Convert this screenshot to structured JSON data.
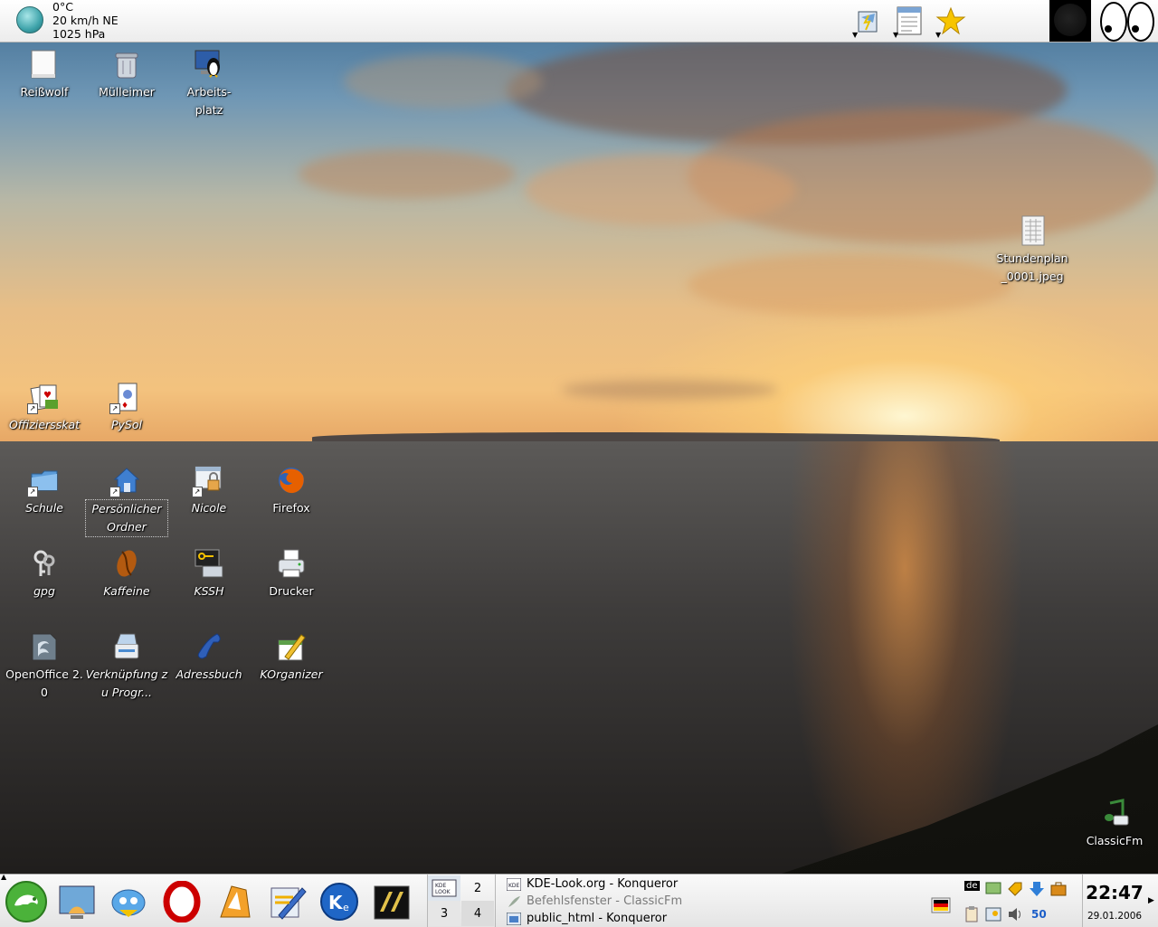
{
  "weather": {
    "temperature": "0°C",
    "wind": "20 km/h NE",
    "pressure": "1025 hPa",
    "icon": "weather-globe-icon"
  },
  "top_panel": {
    "buttons": [
      "klipper-icon",
      "notes-icon",
      "bookmark-star-icon"
    ],
    "applets": [
      "moon-phase",
      "eyes"
    ]
  },
  "desktop": {
    "icons": [
      {
        "name": "shredder",
        "label": "Reißwolf",
        "italic": false
      },
      {
        "name": "trash",
        "label": "Mülleimer",
        "italic": false
      },
      {
        "name": "my-computer",
        "label": "Arbeits-\nplatz",
        "italic": false
      },
      {
        "name": "timetable-file",
        "label": "Stundenplan\n_0001.jpeg",
        "italic": false
      },
      {
        "name": "offiziersskat",
        "label": "Offiziersskat",
        "italic": true
      },
      {
        "name": "pysol",
        "label": "PySol",
        "italic": true
      },
      {
        "name": "schule",
        "label": "Schule",
        "italic": true
      },
      {
        "name": "personal-folder",
        "label": "Persönlicher Ordner",
        "italic": true
      },
      {
        "name": "nicole",
        "label": "Nicole",
        "italic": true
      },
      {
        "name": "firefox",
        "label": "Firefox",
        "italic": false
      },
      {
        "name": "gpg",
        "label": "gpg",
        "italic": true
      },
      {
        "name": "kaffeine",
        "label": "Kaffeine",
        "italic": true
      },
      {
        "name": "kssh",
        "label": "KSSH",
        "italic": true
      },
      {
        "name": "printer",
        "label": "Drucker",
        "italic": false
      },
      {
        "name": "openoffice",
        "label": "OpenOffice 2.0",
        "italic": false
      },
      {
        "name": "link-to-program",
        "label": "Verknüpfung zu Progr...",
        "italic": true
      },
      {
        "name": "addressbook",
        "label": "Adressbuch",
        "italic": true
      },
      {
        "name": "korganizer",
        "label": "KOrganizer",
        "italic": true
      },
      {
        "name": "classicfm",
        "label": "ClassicFm",
        "italic": false
      }
    ]
  },
  "taskbar": {
    "launchers": [
      "suse-menu-icon",
      "desktop-icon",
      "kmail-icon",
      "opera-icon",
      "konqueror-icon",
      "kwrite-icon",
      "kde-ie-icon",
      "yakuake-icon"
    ],
    "pager": {
      "desktops": [
        "1",
        "2",
        "3",
        "4"
      ],
      "active": "1"
    },
    "tasks": [
      {
        "title": "KDE-Look.org - Konqueror",
        "dim": false
      },
      {
        "title": "Befehlsfenster - ClassicFm",
        "dim": true
      },
      {
        "title": "public_html - Konqueror",
        "dim": false
      }
    ],
    "tray": {
      "keyboard_layout": "de",
      "volume_badge": "50"
    },
    "clock": {
      "time": "22:47",
      "date": "29.01.2006"
    }
  }
}
